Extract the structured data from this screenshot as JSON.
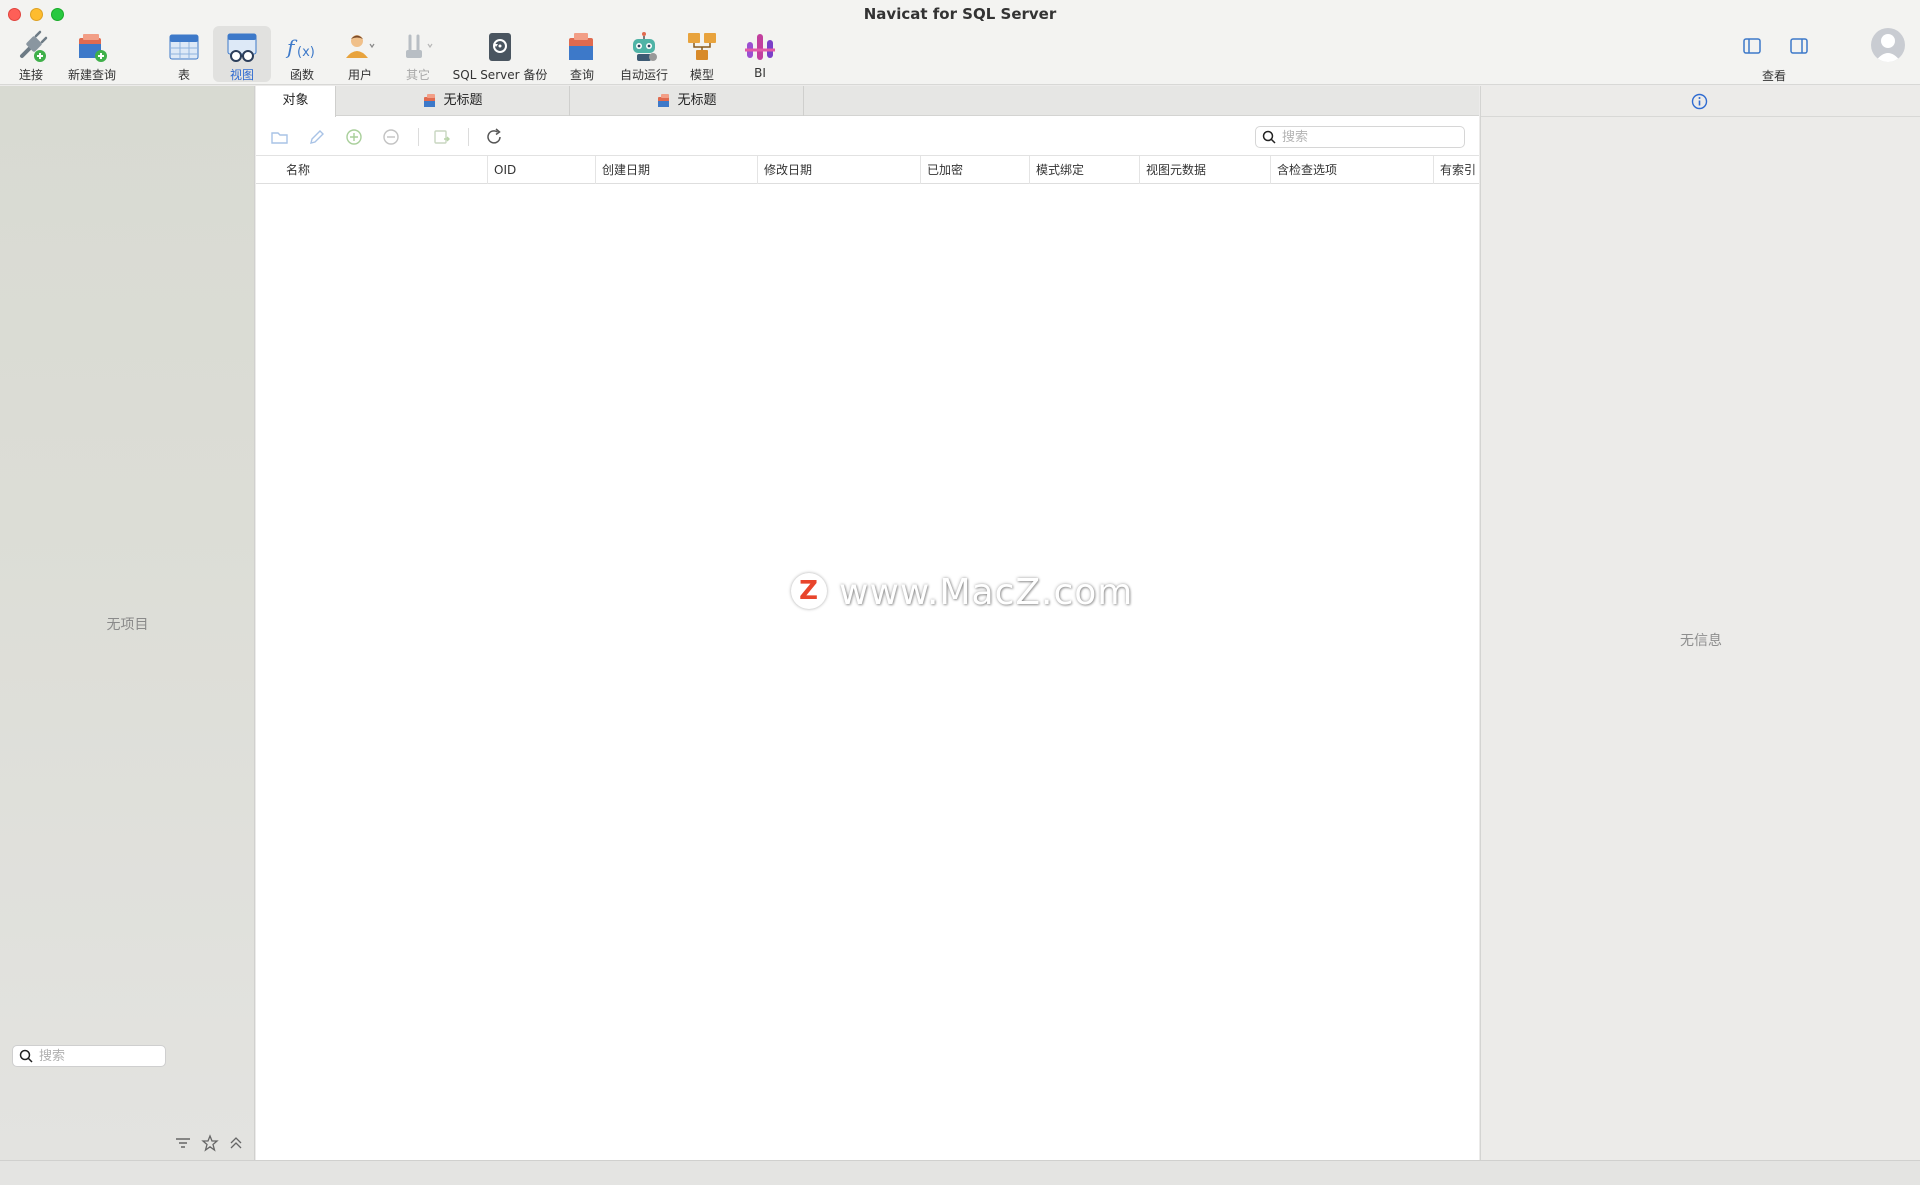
{
  "window": {
    "title": "Navicat for SQL Server"
  },
  "toolbar": {
    "items": [
      {
        "label": "连接",
        "icon": "connection-plug-icon"
      },
      {
        "label": "新建查询",
        "icon": "new-query-icon"
      },
      {
        "label": "表",
        "icon": "table-icon"
      },
      {
        "label": "视图",
        "icon": "view-icon",
        "active": true
      },
      {
        "label": "函数",
        "icon": "function-icon"
      },
      {
        "label": "用户",
        "icon": "user-icon"
      },
      {
        "label": "其它",
        "icon": "other-tools-icon",
        "disabled": true
      },
      {
        "label": "SQL Server 备份",
        "icon": "backup-icon"
      },
      {
        "label": "查询",
        "icon": "query-icon"
      },
      {
        "label": "自动运行",
        "icon": "automation-robot-icon"
      },
      {
        "label": "模型",
        "icon": "model-icon"
      },
      {
        "label": "BI",
        "icon": "bi-icon"
      }
    ],
    "view_label": "查看"
  },
  "sidebar": {
    "empty_text": "无项目",
    "search_placeholder": "搜索"
  },
  "tabs": [
    {
      "label": "对象",
      "active": true
    },
    {
      "label": "无标题"
    },
    {
      "label": "无标题"
    }
  ],
  "objects": {
    "search_placeholder": "搜索",
    "columns": [
      "名称",
      "OID",
      "创建日期",
      "修改日期",
      "已加密",
      "模式绑定",
      "视图元数据",
      "含检查选项",
      "有索引"
    ]
  },
  "info_panel": {
    "empty_text": "无信息"
  },
  "watermark": {
    "text": "www.MacZ.com",
    "logo_letter": "Z"
  },
  "colors": {
    "accent": "#2f6bd1",
    "close": "#fe5f57",
    "minimize": "#febc2e",
    "maximize": "#28c840"
  }
}
